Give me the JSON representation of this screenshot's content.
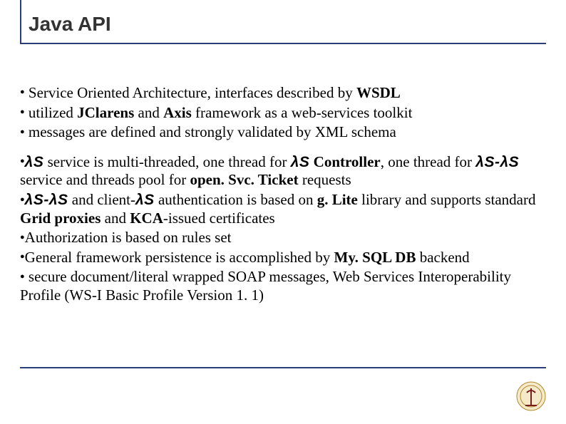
{
  "title": "Java API",
  "group1": {
    "b1_pre": " Service Oriented Architecture, interfaces described by ",
    "b1_bold": "WSDL",
    "b2_pre": " utilized ",
    "b2_bold1": "JClarens",
    "b2_mid": "  and ",
    "b2_bold2": "Axis",
    "b2_post": " framework as a web-services toolkit",
    "b3": " messages are defined and strongly validated by XML schema"
  },
  "group2": {
    "l1_lam1": "λS",
    "l1_a": " service is multi-threaded, one thread for ",
    "l1_lam2": "λS",
    "l1_b": " Controller",
    "l1_c": ", one thread for ",
    "l1_lam3": "λS-λS",
    "l1_d": " service and threads pool for ",
    "l1_bold": "open. Svc. Ticket",
    "l1_e": " requests",
    "l2_lam1": "λS-λS",
    "l2_a": " and client-",
    "l2_lam2": "λS",
    "l2_b": " authentication is based on ",
    "l2_bold1": "g. Lite",
    "l2_c": " library and supports standard ",
    "l2_bold2": "Grid proxies",
    "l2_d": " and ",
    "l2_bold3": "KCA",
    "l2_e": "-issued  certificates",
    "l3": "Authorization is based on rules set",
    "l4_a": "General framework persistence is accomplished by ",
    "l4_bold": "My. SQL DB",
    "l4_b": " backend",
    "l5": " secure document/literal wrapped SOAP messages, Web Services Interoperability Profile (WS-I Basic Profile Version 1. 1)"
  }
}
